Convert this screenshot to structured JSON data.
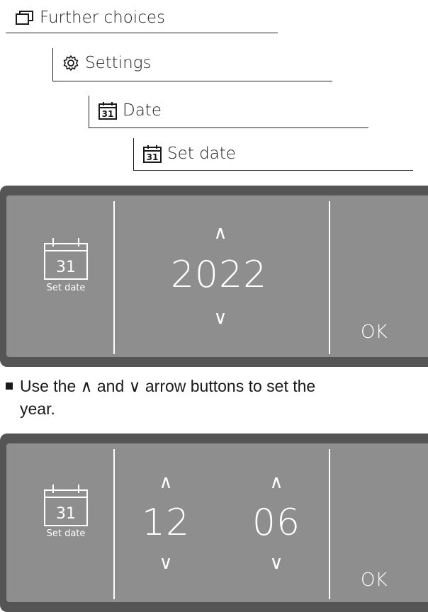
{
  "breadcrumbs": {
    "further_choices": "Further choices",
    "settings": "Settings",
    "date": "Date",
    "set_date": "Set date"
  },
  "calendar_icon_number": "31",
  "panel1": {
    "side_label": "Set date",
    "up_arrow": "∧",
    "value": "2022",
    "down_arrow": "∨",
    "ok_label": "OK"
  },
  "instruction": {
    "line1": "Use the ∧ and ∨ arrow buttons to set the",
    "line2": "year."
  },
  "panel2": {
    "side_label": "Set date",
    "month_up": "∧",
    "month_value": "12",
    "month_down": "∨",
    "day_up": "∧",
    "day_value": "06",
    "day_down": "∨",
    "ok_label": "OK"
  },
  "colors": {
    "panel_frame": "#555555",
    "screen": "#8e8e8e",
    "text_on_screen": "#ffffff"
  },
  "icons": [
    "window-stack-icon",
    "gear-icon",
    "calendar-icon"
  ]
}
